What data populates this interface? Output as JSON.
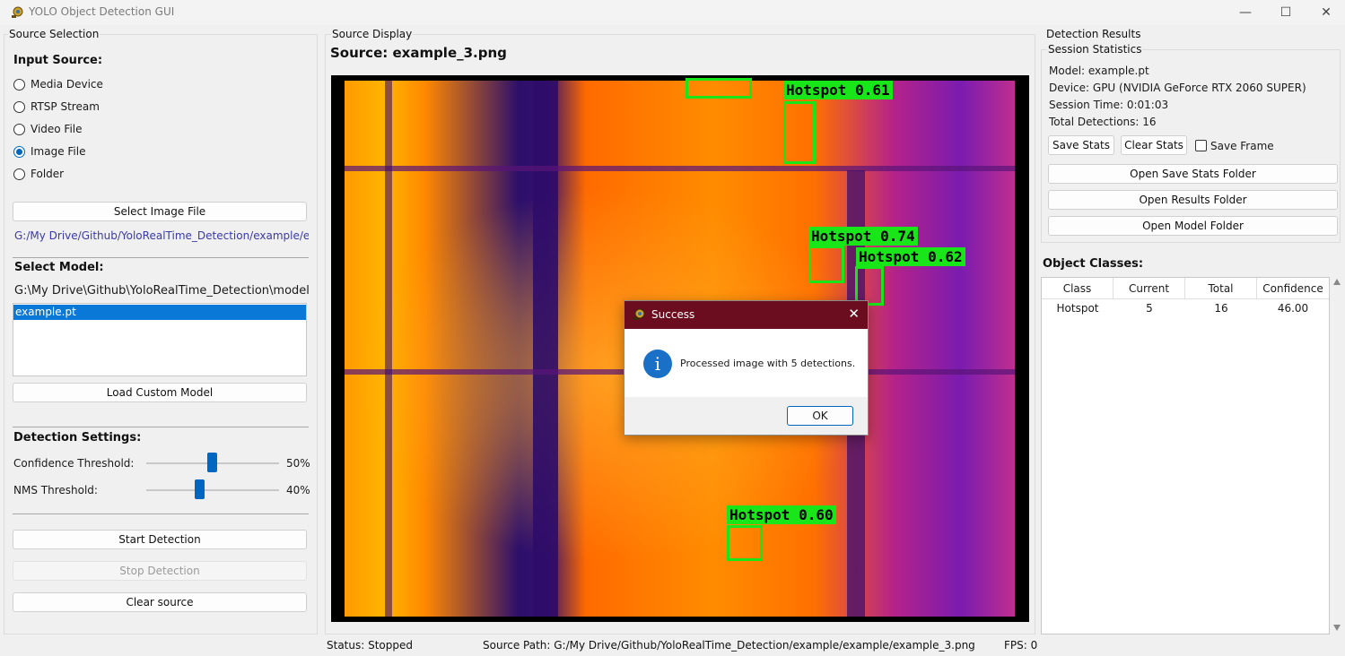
{
  "window": {
    "title": "YOLO Object Detection GUI",
    "minimize": "—",
    "maximize": "☐",
    "close": "✕"
  },
  "source_selection": {
    "group_label": "Source Selection",
    "input_source_label": "Input Source:",
    "options": [
      "Media Device",
      "RTSP Stream",
      "Video File",
      "Image File",
      "Folder"
    ],
    "selected": "Image File",
    "select_file_button": "Select Image File",
    "file_path": "G:/My Drive/Github/YoloRealTime_Detection/example/example/example_3.png"
  },
  "model": {
    "label": "Select Model:",
    "folder": "G:\\My Drive\\Github\\YoloRealTime_Detection\\model",
    "items": [
      "example.pt"
    ],
    "selected": "example.pt",
    "load_button": "Load Custom Model"
  },
  "detection_settings": {
    "label": "Detection Settings:",
    "confidence_label": "Confidence Threshold:",
    "confidence_value": 50,
    "confidence_text": "50%",
    "nms_label": "NMS Threshold:",
    "nms_value": 40,
    "nms_text": "40%"
  },
  "controls": {
    "start": "Start Detection",
    "stop": "Stop Detection",
    "clear": "Clear source"
  },
  "display": {
    "group_label": "Source Display",
    "source_title": "Source: example_3.png",
    "detections": [
      {
        "label": "Hotspot  0.61"
      },
      {
        "label": "Hotspot  0.74"
      },
      {
        "label": "Hotspot  0.62"
      },
      {
        "label": "Hotspot  0.60"
      }
    ]
  },
  "dialog": {
    "title": "Success",
    "message": "Processed image with 5 detections.",
    "ok": "OK",
    "icon": "info-icon"
  },
  "results": {
    "group_label": "Detection Results",
    "stats_label": "Session Statistics",
    "model": "Model: example.pt",
    "device": "Device: GPU (NVIDIA GeForce RTX 2060 SUPER)",
    "session_time": "Session Time: 0:01:03",
    "total_detections": "Total Detections: 16",
    "save_stats": "Save Stats",
    "clear_stats": "Clear Stats",
    "save_frame": "Save Frame",
    "open_save_stats_folder": "Open Save Stats Folder",
    "open_results_folder": "Open Results Folder",
    "open_model_folder": "Open Model Folder",
    "object_classes_label": "Object Classes:",
    "table_headers": [
      "Class",
      "Current",
      "Total",
      "Confidence"
    ],
    "table_rows": [
      [
        "Hotspot",
        "5",
        "16",
        "46.00"
      ]
    ]
  },
  "status_bar": {
    "status": "Status: Stopped",
    "source_path": "Source Path: G:/My Drive/Github/YoloRealTime_Detection/example/example/example_3.png",
    "fps": "FPS: 0"
  }
}
